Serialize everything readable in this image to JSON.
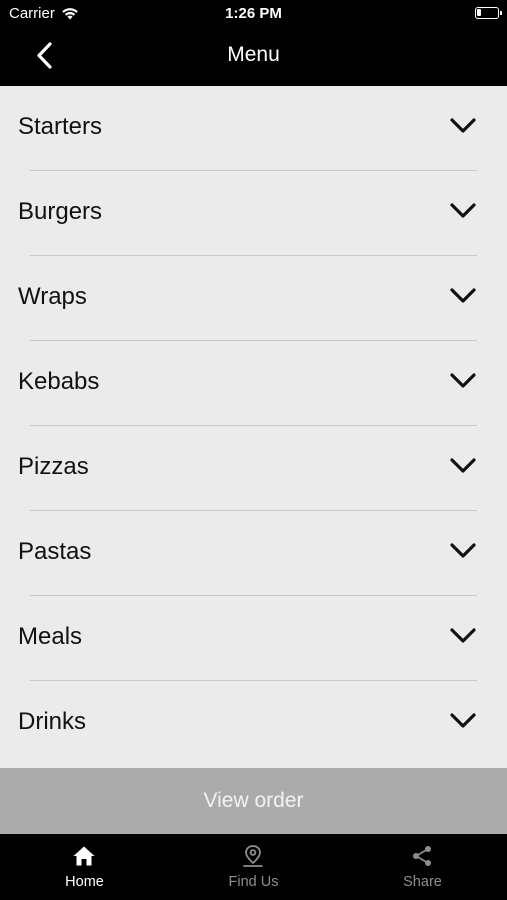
{
  "status_bar": {
    "carrier": "Carrier",
    "time": "1:26 PM"
  },
  "nav": {
    "title": "Menu"
  },
  "menu": {
    "items": [
      {
        "label": "Starters"
      },
      {
        "label": "Burgers"
      },
      {
        "label": "Wraps"
      },
      {
        "label": "Kebabs"
      },
      {
        "label": "Pizzas"
      },
      {
        "label": "Pastas"
      },
      {
        "label": "Meals"
      },
      {
        "label": "Drinks"
      }
    ]
  },
  "view_order": {
    "label": "View order"
  },
  "tabs": [
    {
      "label": "Home",
      "icon": "home-icon",
      "active": true
    },
    {
      "label": "Find Us",
      "icon": "map-pin-icon",
      "active": false
    },
    {
      "label": "Share",
      "icon": "share-icon",
      "active": false
    }
  ],
  "colors": {
    "bar_background": "#000000",
    "list_background": "#ebebeb",
    "view_order_background": "#ababab",
    "tab_active": "#ffffff",
    "tab_inactive": "#8e8e8e"
  }
}
